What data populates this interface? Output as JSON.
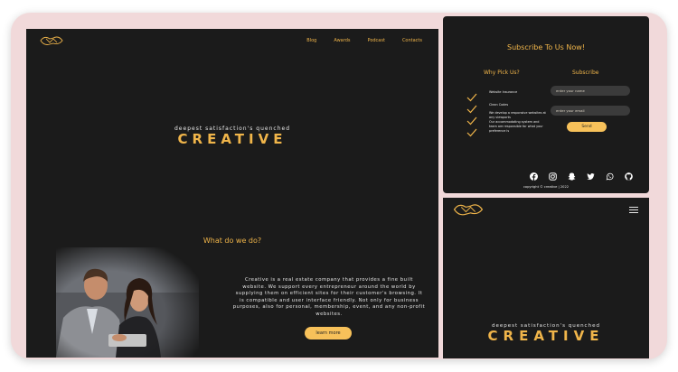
{
  "main": {
    "nav": [
      "Blog",
      "Awards",
      "Podcast",
      "Contacts"
    ],
    "tagline": "deepest satisfaction's quenched",
    "hero": "CREATIVE",
    "section_title": "What do we do?",
    "description": "Creative is a real estate company that provides a fine built website. We support every entrepreneur around the world by supplying them on efficient sites for their customer's browsing. It is compatible and user interface friendly. Not only for business purposes, also for personal, membership, event, and any non-profit websites.",
    "cta": "learn more"
  },
  "subscribe": {
    "title": "Subscribe To Us Now!",
    "why_title": "Why Pick Us?",
    "form_title": "Subscribe",
    "reasons": [
      "Website Insurance",
      "Clean Codes",
      "We develop a responsive websites at any viewports",
      "Our accommodating system and team are responsible for what your preference is"
    ],
    "name_placeholder": "enter your name",
    "email_placeholder": "enter your email",
    "send_label": "Send",
    "social_icons": [
      "facebook-icon",
      "instagram-icon",
      "snapchat-icon",
      "twitter-icon",
      "whatsapp-icon",
      "github-icon"
    ],
    "copyright": "copyright © creative | 2022"
  },
  "mobile": {
    "tagline": "deepest satisfaction's quenched",
    "hero": "CREATIVE"
  },
  "colors": {
    "accent": "#f0b54a",
    "button": "#f7c15a",
    "panel": "#1b1b1b",
    "frame": "#f1d9da"
  }
}
